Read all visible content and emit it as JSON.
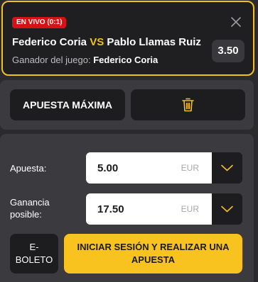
{
  "selection": {
    "live_badge": "EN VIVO (0:1)",
    "home_player": "Federico Coria",
    "vs": "VS",
    "away_player": "Pablo Llamas Ruiz",
    "market_label": "Ganador del juego:",
    "market_pick": "Federico Coria",
    "odds": "3.50",
    "close_icon": "close-icon"
  },
  "actions": {
    "max_bet_label": "APUESTA MÁXIMA",
    "trash_icon": "trash-icon"
  },
  "stake": {
    "stake_label": "Apuesta:",
    "stake_value": "5.00",
    "stake_currency": "EUR",
    "winnings_label_line1": "Ganancia",
    "winnings_label_line2": "posible:",
    "winnings_value": "17.50",
    "winnings_currency": "EUR",
    "dropdown_icon": "chevron-down-icon"
  },
  "footer": {
    "eticket_line1": "E-",
    "eticket_line2": "BOLETO",
    "login_bet_line1": "INICIAR SESIÓN Y REALIZAR UNA",
    "login_bet_line2": "APUESTA"
  },
  "colors": {
    "accent": "#f5bf22",
    "live_red": "#d41414",
    "panel": "#3a3a3f",
    "button_dark": "#1d1d20",
    "primary_button": "#f9c31f"
  }
}
